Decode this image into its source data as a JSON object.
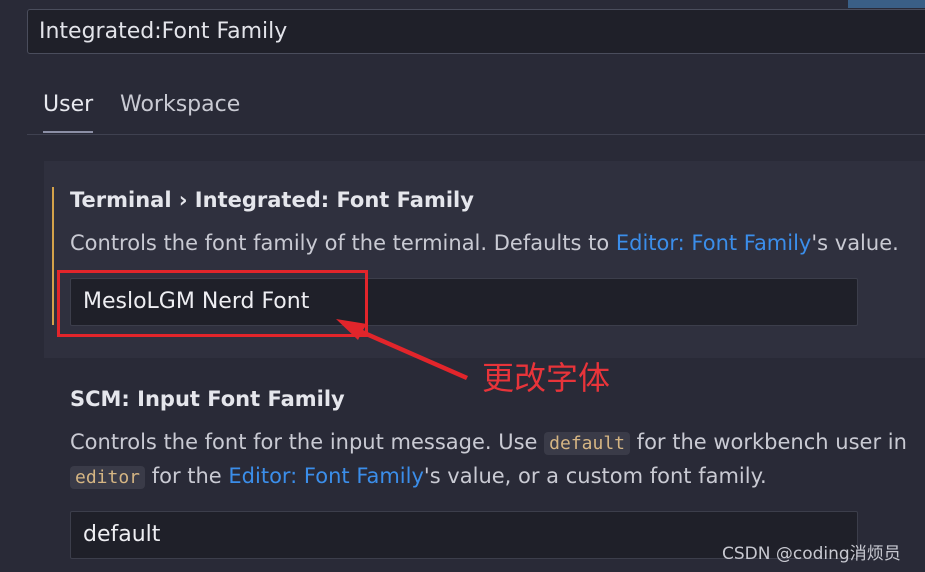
{
  "search": {
    "value": "Integrated:Font Family"
  },
  "tabs": [
    {
      "label": "User"
    },
    {
      "label": "Workspace"
    }
  ],
  "setting1": {
    "title": "Terminal › Integrated: Font Family",
    "desc_prefix": "Controls the font family of the terminal. Defaults to ",
    "desc_link": "Editor: Font Family",
    "desc_suffix": "'s value.",
    "value": "MesloLGM Nerd Font"
  },
  "annotation": {
    "text": "更改字体",
    "color": "#e2252b"
  },
  "setting2": {
    "title": "SCM: Input Font Family",
    "line1_prefix": "Controls the font for the input message. Use ",
    "line1_code": "default",
    "line1_suffix": " for the workbench user in",
    "line2_code": "editor",
    "line2_mid": " for the ",
    "line2_link": "Editor: Font Family",
    "line2_suffix": "'s value, or a custom font family.",
    "value": "default"
  },
  "watermark": "CSDN @coding消烦员"
}
